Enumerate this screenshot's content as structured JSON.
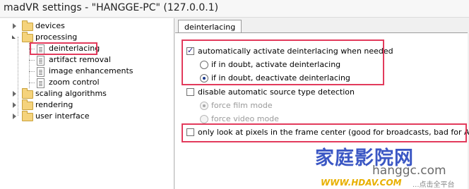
{
  "window": {
    "title": "madVR settings - \"HANGGE-PC\" (127.0.0.1)"
  },
  "tree": {
    "items": [
      {
        "label": "devices",
        "expanded": false
      },
      {
        "label": "processing",
        "expanded": true,
        "children": [
          {
            "label": "deinterlacing",
            "selected": true
          },
          {
            "label": "artifact removal"
          },
          {
            "label": "image enhancements"
          },
          {
            "label": "zoom control"
          }
        ]
      },
      {
        "label": "scaling algorithms",
        "expanded": false
      },
      {
        "label": "rendering",
        "expanded": false
      },
      {
        "label": "user interface",
        "expanded": false
      }
    ]
  },
  "tab": {
    "label": "deinterlacing"
  },
  "options": {
    "auto_activate": {
      "label": "automatically activate deinterlacing when needed",
      "checked": true
    },
    "if_doubt_activate": {
      "label": "if in doubt, activate deinterlacing",
      "selected": false
    },
    "if_doubt_deactivate": {
      "label": "if in doubt, deactivate deinterlacing",
      "selected": true
    },
    "disable_source_detection": {
      "label": "disable automatic source type detection",
      "checked": false
    },
    "force_film": {
      "label": "force film mode",
      "selected": true,
      "disabled": true
    },
    "force_video": {
      "label": "force video mode",
      "selected": false,
      "disabled": true
    },
    "frame_center": {
      "label": "only look at pixels in the frame center  (good for broadcasts, bad for Anime)",
      "checked": false
    }
  },
  "watermark": {
    "main": "家庭影院网",
    "sub": "hanggc.com",
    "url": "WWW.HDAV.COM",
    "tail": "...点击全平台"
  },
  "colors": {
    "highlight": "#e23b5c",
    "watermark_blue": "#3b57c4",
    "watermark_yellow": "#e8b000"
  }
}
